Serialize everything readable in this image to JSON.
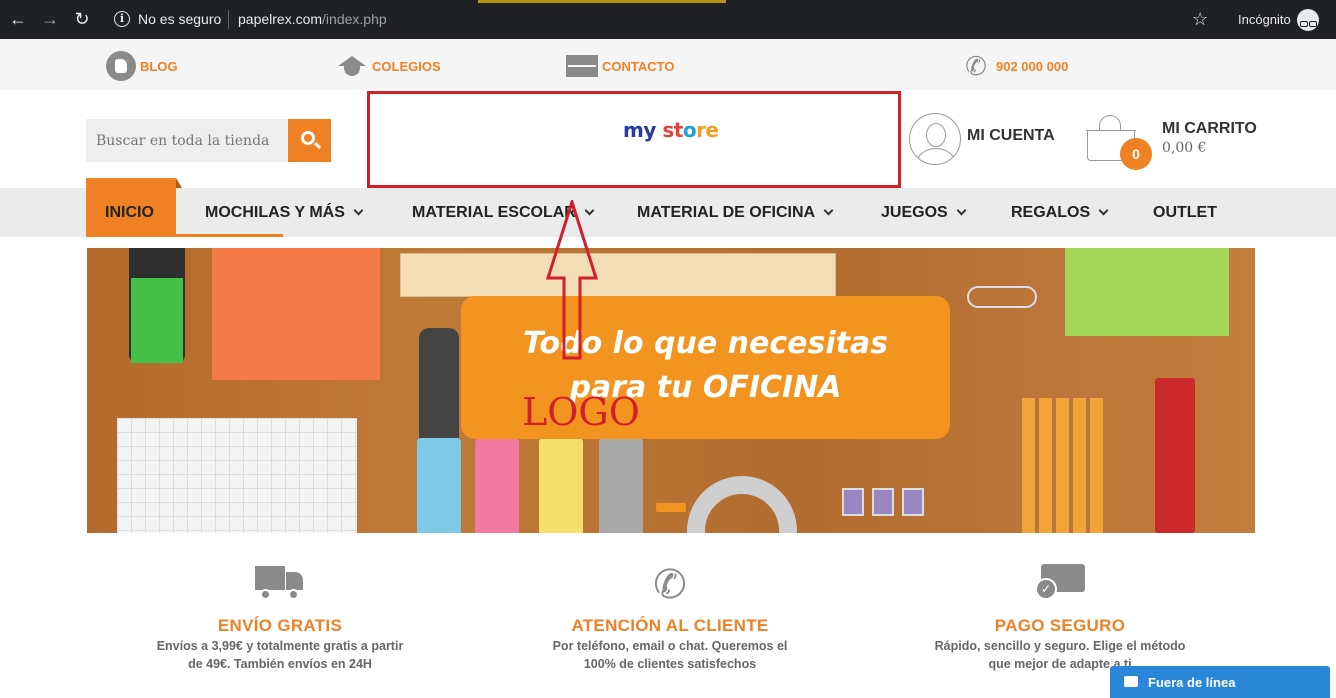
{
  "browser": {
    "not_secure": "No es seguro",
    "url_domain": "papelrex.com",
    "url_path": "/index.php",
    "incognito": "Incógnito"
  },
  "topbar": {
    "blog": "BLOG",
    "schools": "COLEGIOS",
    "contact": "CONTACTO",
    "phone": "902 000 000"
  },
  "header": {
    "search_placeholder": "Buscar en toda la tienda",
    "logo": {
      "part1": "my ",
      "part2": "st",
      "part3": "o",
      "part4": "re"
    },
    "account": "MI CUENTA",
    "cart": {
      "title": "MI CARRITO",
      "count": "0",
      "total": "0,00 €"
    }
  },
  "nav": {
    "items": [
      {
        "label": "INICIO"
      },
      {
        "label": "MOCHILAS Y MÁS"
      },
      {
        "label": "MATERIAL ESCOLAR"
      },
      {
        "label": "MATERIAL DE OFICINA"
      },
      {
        "label": "JUEGOS"
      },
      {
        "label": "REGALOS"
      },
      {
        "label": "OUTLET"
      }
    ]
  },
  "banner": {
    "line1": "Todo lo que necesitas",
    "line2": "para tu OFICINA"
  },
  "annotation": {
    "label": "LOGO",
    "color": "#d1202a"
  },
  "features": [
    {
      "title": "ENVÍO GRATIS",
      "desc1": "Envíos a 3,99€ y totalmente gratis a partir",
      "desc2": "de 49€. También envíos en 24H"
    },
    {
      "title": "ATENCIÓN AL CLIENTE",
      "desc1": "Por teléfono, email o chat. Queremos el",
      "desc2": "100% de clientes satisfechos"
    },
    {
      "title": "PAGO SEGURO",
      "desc1": "Rápido, sencillo y seguro. Elige el método",
      "desc2": "que mejor de adapte a ti"
    }
  ],
  "chat": {
    "label": "Fuera de línea"
  },
  "colors": {
    "accent": "#f08024",
    "annotation_red": "#d1202a",
    "chat_blue": "#2a87d8"
  }
}
